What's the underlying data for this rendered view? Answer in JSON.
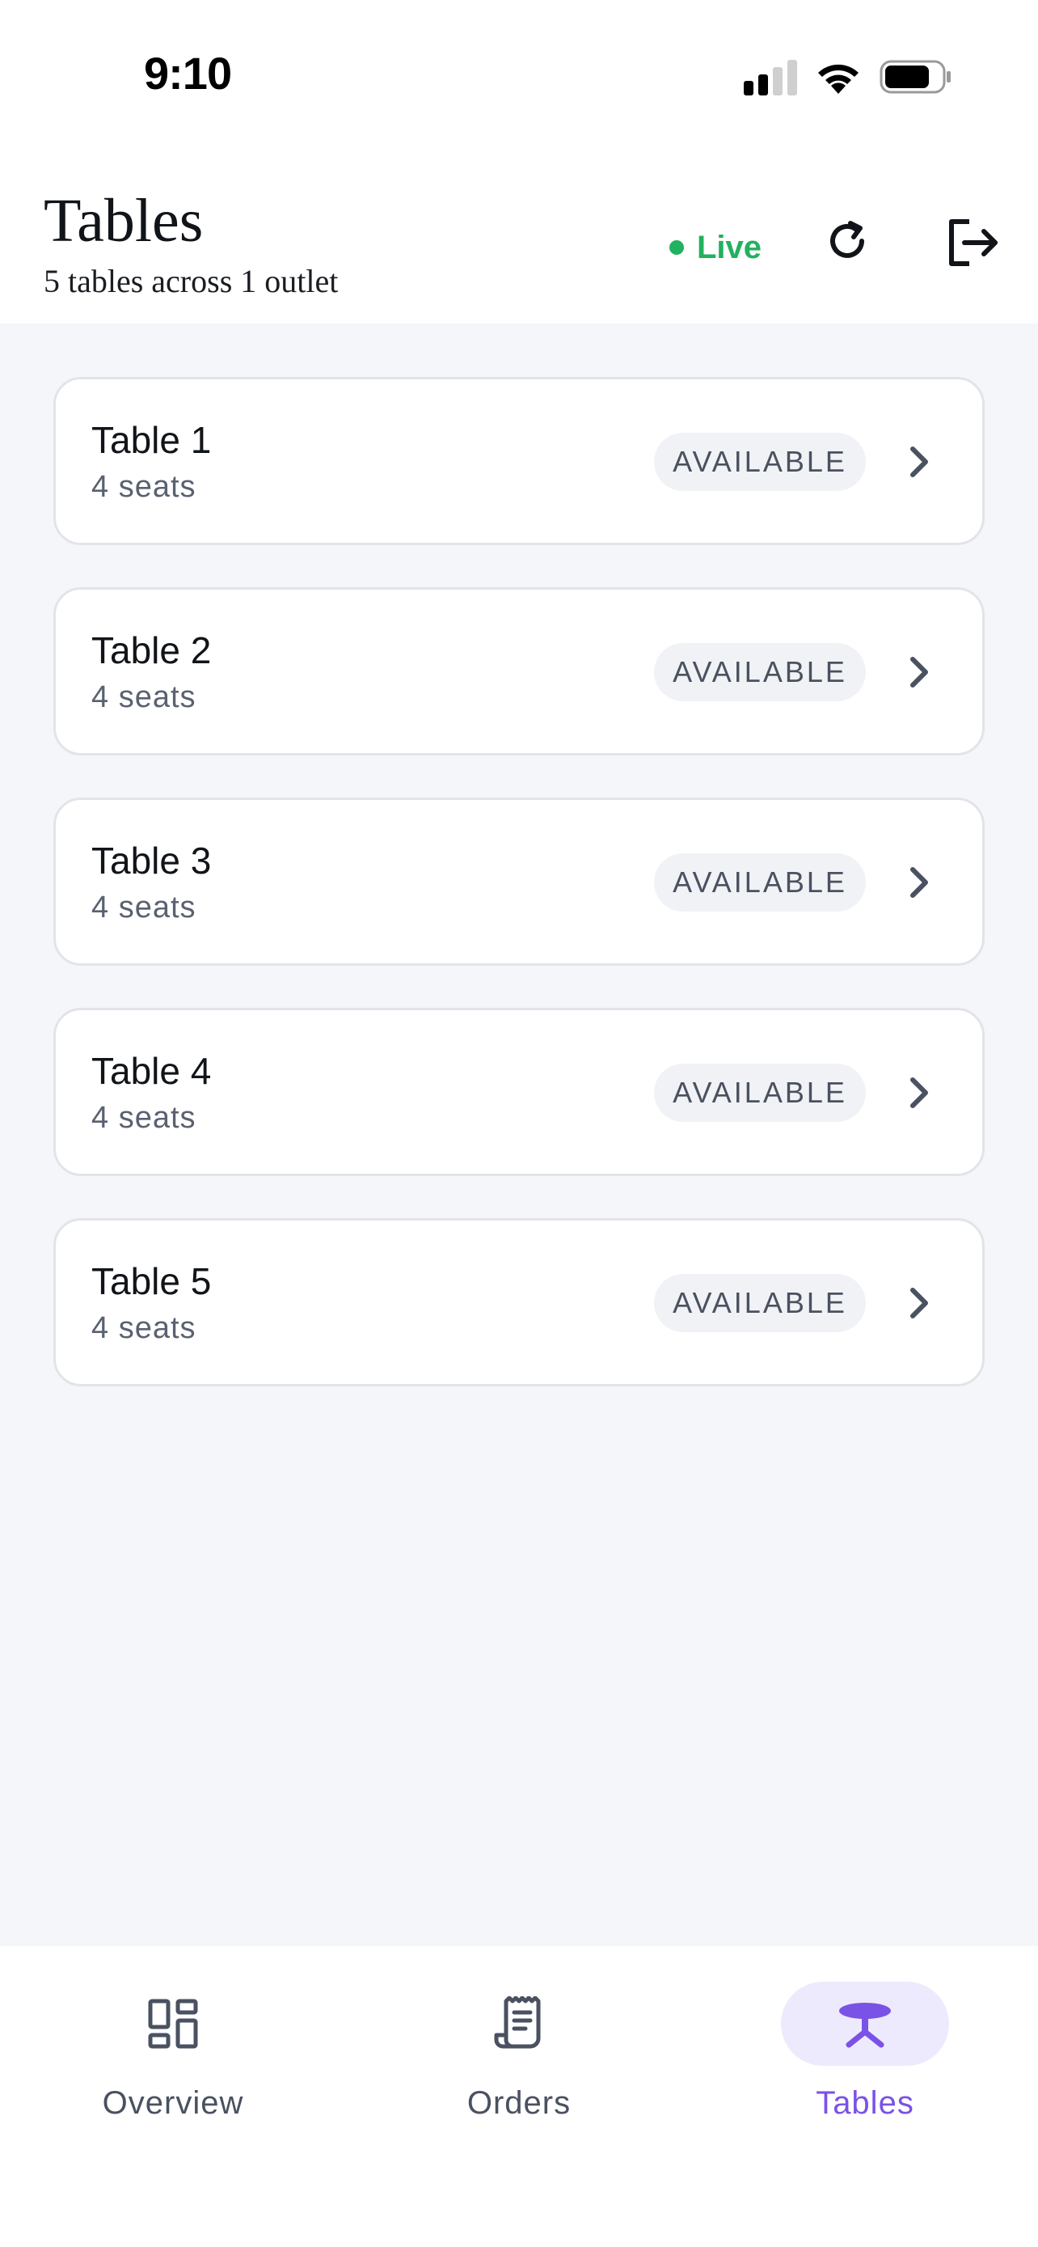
{
  "status_bar": {
    "time": "9:10"
  },
  "header": {
    "title": "Tables",
    "subtitle": "5 tables across 1 outlet",
    "live_label": "Live"
  },
  "tables": [
    {
      "name": "Table 1",
      "seats": "4 seats",
      "status": "AVAILABLE"
    },
    {
      "name": "Table 2",
      "seats": "4 seats",
      "status": "AVAILABLE"
    },
    {
      "name": "Table 3",
      "seats": "4 seats",
      "status": "AVAILABLE"
    },
    {
      "name": "Table 4",
      "seats": "4 seats",
      "status": "AVAILABLE"
    },
    {
      "name": "Table 5",
      "seats": "4 seats",
      "status": "AVAILABLE"
    }
  ],
  "nav": {
    "overview": "Overview",
    "orders": "Orders",
    "tables": "Tables",
    "active": "tables"
  },
  "colors": {
    "accent": "#7A52E6",
    "live": "#22B15E",
    "background": "#F5F6FA"
  },
  "icons": {
    "refresh": "refresh-icon",
    "logout": "logout-icon",
    "overview": "dashboard-grid-icon",
    "orders": "receipt-icon",
    "tables": "table-icon"
  }
}
